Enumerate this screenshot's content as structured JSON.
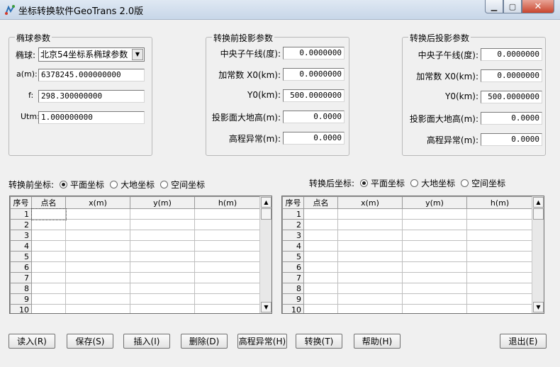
{
  "window": {
    "title": "坐标转换软件GeoTrans 2.0版",
    "min_glyph": "▁",
    "max_glyph": "▢",
    "close_glyph": "✕"
  },
  "ellipsoid": {
    "legend": "椭球参数",
    "ellipsoid_label": "椭球:",
    "ellipsoid_value": "北京54坐标系椭球参数",
    "a_label": "a(m):",
    "a_value": "6378245.000000000",
    "f_label": "f:",
    "f_value": "298.300000000",
    "utm_label": "Utm:",
    "utm_value": "1.000000000"
  },
  "proj_before": {
    "legend": "转换前投影参数",
    "fields": [
      {
        "label": "中央子午线(度):",
        "value": "0.0000000"
      },
      {
        "label": "加常数 X0(km):",
        "value": "0.0000000"
      },
      {
        "label": "Y0(km):",
        "value": "500.0000000"
      },
      {
        "label": "投影面大地高(m):",
        "value": "0.0000"
      },
      {
        "label": "高程异常(m):",
        "value": "0.0000"
      }
    ]
  },
  "proj_after": {
    "legend": "转换后投影参数",
    "fields": [
      {
        "label": "中央子午线(度):",
        "value": "0.0000000"
      },
      {
        "label": "加常数 X0(km):",
        "value": "0.0000000"
      },
      {
        "label": "Y0(km):",
        "value": "500.0000000"
      },
      {
        "label": "投影面大地高(m):",
        "value": "0.0000"
      },
      {
        "label": "高程异常(m):",
        "value": "0.0000"
      }
    ]
  },
  "coord_before": {
    "label": "转换前坐标:",
    "options": [
      "平面坐标",
      "大地坐标",
      "空间坐标"
    ],
    "selected": 0
  },
  "coord_after": {
    "label": "转换后坐标:",
    "options": [
      "平面坐标",
      "大地坐标",
      "空间坐标"
    ],
    "selected": 0
  },
  "grid": {
    "headers": [
      "序号",
      "点名",
      "x(m)",
      "y(m)",
      "h(m)"
    ],
    "rows": [
      "1",
      "2",
      "3",
      "4",
      "5",
      "6",
      "7",
      "8",
      "9",
      "10"
    ]
  },
  "scroll": {
    "up_glyph": "▲",
    "down_glyph": "▼",
    "dd_glyph": "▼"
  },
  "buttons": {
    "read": "读入(R)",
    "save": "保存(S)",
    "insert": "插入(I)",
    "delete": "删除(D)",
    "height_anomaly": "高程异常(H)",
    "convert": "转换(T)",
    "help": "帮助(H)",
    "exit": "退出(E)"
  }
}
